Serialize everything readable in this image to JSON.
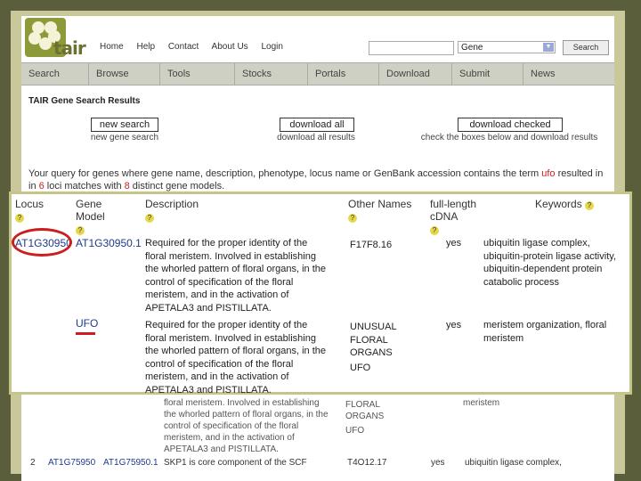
{
  "header": {
    "logo_text": "tair",
    "toplinks": [
      "Home",
      "Help",
      "Contact",
      "About Us",
      "Login"
    ],
    "search": {
      "value": "",
      "select_value": "Gene",
      "button_label": "Search"
    }
  },
  "nav": [
    "Search",
    "Browse",
    "Tools",
    "Stocks",
    "Portals",
    "Download",
    "Submit",
    "News"
  ],
  "results": {
    "title": "TAIR Gene Search Results",
    "actions": [
      {
        "label": "new search",
        "sub": "new gene search"
      },
      {
        "label": "download all",
        "sub": "download all results"
      },
      {
        "label": "download checked",
        "sub": "check the boxes below and download results"
      }
    ],
    "query_before": "Your query for genes where gene name, description, phenotype, locus name or GenBank accession contains the term ",
    "query_term": "ufo",
    "query_mid": " resulted in ",
    "loci_count": "6",
    "query_mid2": " loci matches with ",
    "model_count": "8",
    "query_after": " distinct gene models."
  },
  "zoom": {
    "headers": {
      "locus": "Locus",
      "gene_model_1": "Gene",
      "gene_model_2": "Model",
      "description": "Description",
      "other_names": "Other Names",
      "fl_1": "full-length",
      "fl_2": "cDNA",
      "keywords": "Keywords"
    },
    "help_mark": "?",
    "row1": {
      "locus": "AT1G30950",
      "model": "AT1G30950.1",
      "description": [
        "Required for the proper identity of the",
        "floral meristem. Involved in establishing",
        "the whorled pattern of floral organs, in the",
        "control of specification of the floral",
        "meristem, and in the activation of",
        "APETALA3 and PISTILLATA."
      ],
      "other_names": "F17F8.16",
      "fl": "yes",
      "keywords": [
        "ubiquitin ligase complex,",
        "ubiquitin-protein ligase activity,",
        "ubiquitin-dependent protein",
        "catabolic process"
      ]
    },
    "row1b": {
      "model": "UFO",
      "description": [
        "Required for the proper identity of the",
        "floral meristem. Involved in establishing",
        "the whorled pattern of floral organs, in the",
        "control of specification of the floral",
        "meristem, and in the activation of",
        "APETALA3 and PISTILLATA."
      ],
      "other_names": [
        "UNUSUAL",
        "FLORAL",
        "ORGANS",
        "UFO"
      ],
      "fl": "yes",
      "keywords": [
        "meristem organization, floral",
        "meristem"
      ]
    }
  },
  "faded": {
    "desc": [
      "floral meristem. Involved in establishing",
      "the whorled pattern of floral organs, in the",
      "control of specification of the floral",
      "meristem, and in the activation of",
      "APETALA3 and PISTILLATA."
    ],
    "names": [
      "FLORAL",
      "ORGANS",
      "UFO"
    ],
    "kw": "meristem"
  },
  "row2": {
    "num": "2",
    "locus": "AT1G75950",
    "model": "AT1G75950.1",
    "description": "SKP1 is core component of the SCF",
    "other_names": "T4O12.17",
    "fl": "yes",
    "keywords": "ubiquitin ligase complex,"
  },
  "colors": {
    "accent": "#cc1e1e",
    "link": "#1e3a8e",
    "frame": "#c5c58a"
  }
}
